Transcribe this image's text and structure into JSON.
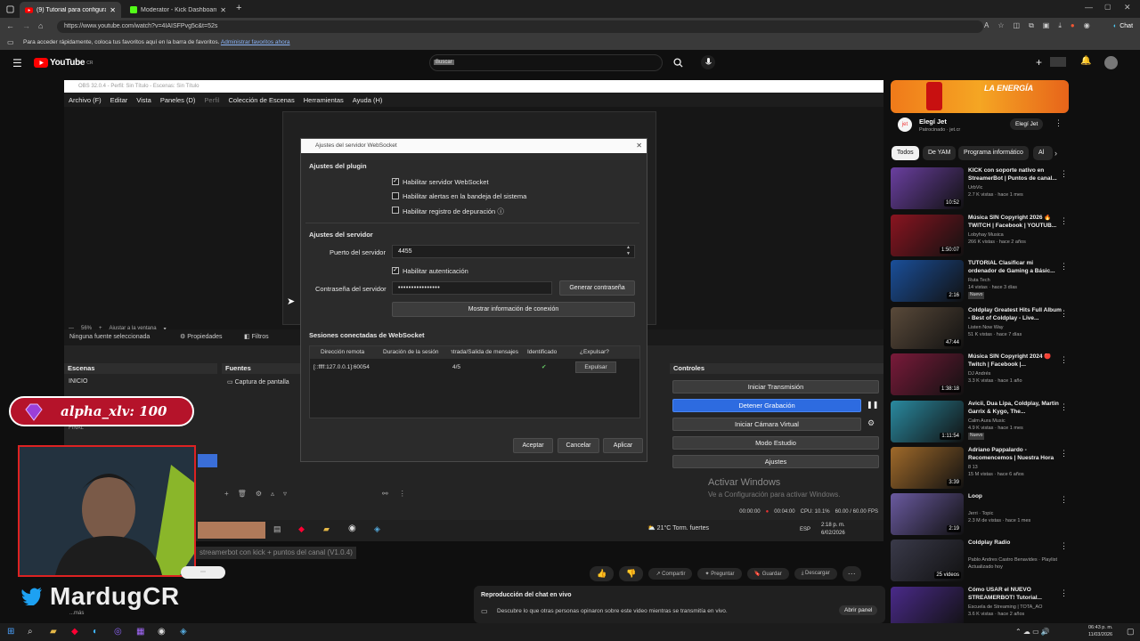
{
  "browser": {
    "tabs": [
      {
        "label": "(9) Tutorial para configurar streamerbot",
        "active": true
      },
      {
        "label": "Moderator - Kick Dashboard",
        "active": false
      }
    ],
    "url": "https://www.youtube.com/watch?v=4IAISFPvg5c&t=52s",
    "bookmarks_text": "Para acceder rápidamente, coloca tus favoritos aquí en la barra de favoritos.",
    "bookmarks_link": "Administrar favoritos ahora",
    "profile_label": "Chat"
  },
  "youtube": {
    "logo_text": "YouTube",
    "logo_sup": "CR",
    "search_value": "Buscar"
  },
  "obs": {
    "window_title": "OBS 32.0.4 - Perfil: Sin Título - Escenas: Sin Título",
    "menu": [
      "Archivo (F)",
      "Editar",
      "Vista",
      "Paneles (D)",
      "Perfil",
      "Colección de Escenas",
      "Herramientas",
      "Ayuda (H)"
    ],
    "zoom_label": "56%",
    "fit_label": "Ajustar a la ventana",
    "no_source": "Ninguna fuente seleccionada",
    "properties": "Propiedades",
    "filters": "Filtros",
    "scenes_header": "Escenas",
    "scene_items": [
      "INICIO",
      "FINAL"
    ],
    "sources_header": "Fuentes",
    "source_item": "Captura de pantalla",
    "controls_header": "Controles",
    "controls": [
      "Iniciar Transmisión",
      "Detener Grabación",
      "Iniciar Cámara Virtual",
      "Modo Estudio",
      "Ajustes"
    ],
    "status": {
      "recording": "00:04:00",
      "stream_time": "00:00:00",
      "cpu": "CPU: 10.1%",
      "fps": "60.00 / 60.00 FPS"
    },
    "activate_windows_title": "Activar Windows",
    "activate_windows_sub": "Ve a Configuración para activar Windows."
  },
  "websocket_dialog": {
    "title": "Ajustes del servidor WebSocket",
    "plugin_header": "Ajustes del plugin",
    "enable_server": "Habilitar servidor WebSocket",
    "enable_alerts": "Habilitar alertas en la bandeja del sistema",
    "enable_debug": "Habilitar registro de depuración",
    "server_header": "Ajustes del servidor",
    "port_label": "Puerto del servidor",
    "port_value": "4455",
    "auth_label": "Habilitar autenticación",
    "password_label": "Contraseña del servidor",
    "password_value": "••••••••••••••••",
    "generate_password": "Generar contraseña",
    "show_connection": "Mostrar información de conexión",
    "sessions_header": "Sesiones conectadas de WebSocket",
    "columns": [
      "Dirección remota",
      "Duración de la sesión",
      "Entrada/Salida de mensajes",
      "Identificado",
      "¿Expulsar?"
    ],
    "row": {
      "address": "[::ffff:127.0.0.1]:60054",
      "duration": "",
      "messages": "4/5",
      "kick": "Expulsar"
    },
    "accept": "Aceptar",
    "cancel": "Cancelar",
    "apply": "Aplicar"
  },
  "overlay": {
    "alert_name": "alpha_xlv: 100",
    "twitter_handle": "MardugCR",
    "subtitle": "streamerbot con kick + puntos del canal (V1.0.4)"
  },
  "windows_in_video": {
    "weather": "21°C  Torm. fuertes",
    "lang": "ESP",
    "time": "2:18 p. m.",
    "date": "6/02/2026"
  },
  "video_actions": {
    "share": "Compartir",
    "ask": "Preguntar",
    "save": "Guardar",
    "download": "Descargar",
    "more": "...más"
  },
  "live_chat": {
    "title": "Reproducción del chat en vivo",
    "desc": "Descubre lo que otras personas opinaron sobre este video mientras se transmitía en vivo.",
    "open": "Abrir panel"
  },
  "ad": {
    "brand_title": "Elegí Jet",
    "sponsored": "Patrocinado · jet.cr",
    "cta": "Elegí Jet",
    "banner_text": "LA ENERGÍA"
  },
  "chips": [
    "Todos",
    "De YAM",
    "Programa informático",
    "Al"
  ],
  "recommendations": [
    {
      "title": "KICK con soporte nativo en StreamerBot | Puntos de canal...",
      "channel": "UrbVic",
      "meta": "2.7 K vistas · hace 1 mes",
      "duration": "10:52",
      "badge": "",
      "thumb": "#6a3fa0"
    },
    {
      "title": "Música SIN Copyright 2026 🔥 TWITCH | Facebook | YOUTUB...",
      "channel": "Lobyhay Musica",
      "meta": "266 K vistas · hace 2 años",
      "duration": "1:50:07",
      "badge": "",
      "thumb": "#8a1420"
    },
    {
      "title": "TUTORIAL Clasificar mi ordenador de Gaming a Básic...",
      "channel": "Ruta Tech",
      "meta": "14 vistas · hace 3 días",
      "duration": "2:16",
      "badge": "Nuevo",
      "thumb": "#1a4f9a"
    },
    {
      "title": "Coldplay Greatest Hits Full Album - Best of Coldplay - Live...",
      "channel": "Listen Now Way",
      "meta": "51 K vistas · hace 7 días",
      "duration": "47:44",
      "badge": "",
      "thumb": "#5a4a3a"
    },
    {
      "title": "Música SIN Copyright 2024 🔴 Twitch | Facebook |...",
      "channel": "DJ Andrés",
      "meta": "3.3 K vistas · hace 1 año",
      "duration": "1:38:18",
      "badge": "",
      "thumb": "#7a1a3a"
    },
    {
      "title": "Avicii, Dua Lipa, Coldplay, Martin Garrix & Kygo, The...",
      "channel": "Calm Aura Music",
      "meta": "4.9 K vistas · hace 1 mes",
      "duration": "1:11:54",
      "badge": "Nuevo",
      "thumb": "#2a8aa0"
    },
    {
      "title": "Adriano Pappalardo - Recomencemos | Nuestra Hora",
      "channel": "8 13",
      "meta": "15 M vistas · hace 6 años",
      "duration": "3:39",
      "badge": "",
      "thumb": "#a06a2a"
    },
    {
      "title": "Loop",
      "channel": "Jerri · Topic",
      "meta": "2.3 M de vistas · hace 1 mes",
      "duration": "2:19",
      "badge": "",
      "thumb": "#6a5aa0"
    },
    {
      "title": "Coldplay Radio",
      "channel": "Pablo Andres Castro Benavides · Playlist",
      "meta": "Actualizado hoy",
      "duration": "25 videos",
      "badge": "",
      "thumb": "#3a3a4a"
    },
    {
      "title": "Cómo USAR el NUEVO STREAMERBOT! Tutorial...",
      "channel": "Escuela de Streaming | TOTA_AO",
      "meta": "3.6 K vistas · hace 2 años",
      "duration": "",
      "badge": "",
      "thumb": "#4a2a8a"
    }
  ],
  "taskbar": {
    "time": "06:43 p. m.",
    "date": "11/03/2026"
  }
}
